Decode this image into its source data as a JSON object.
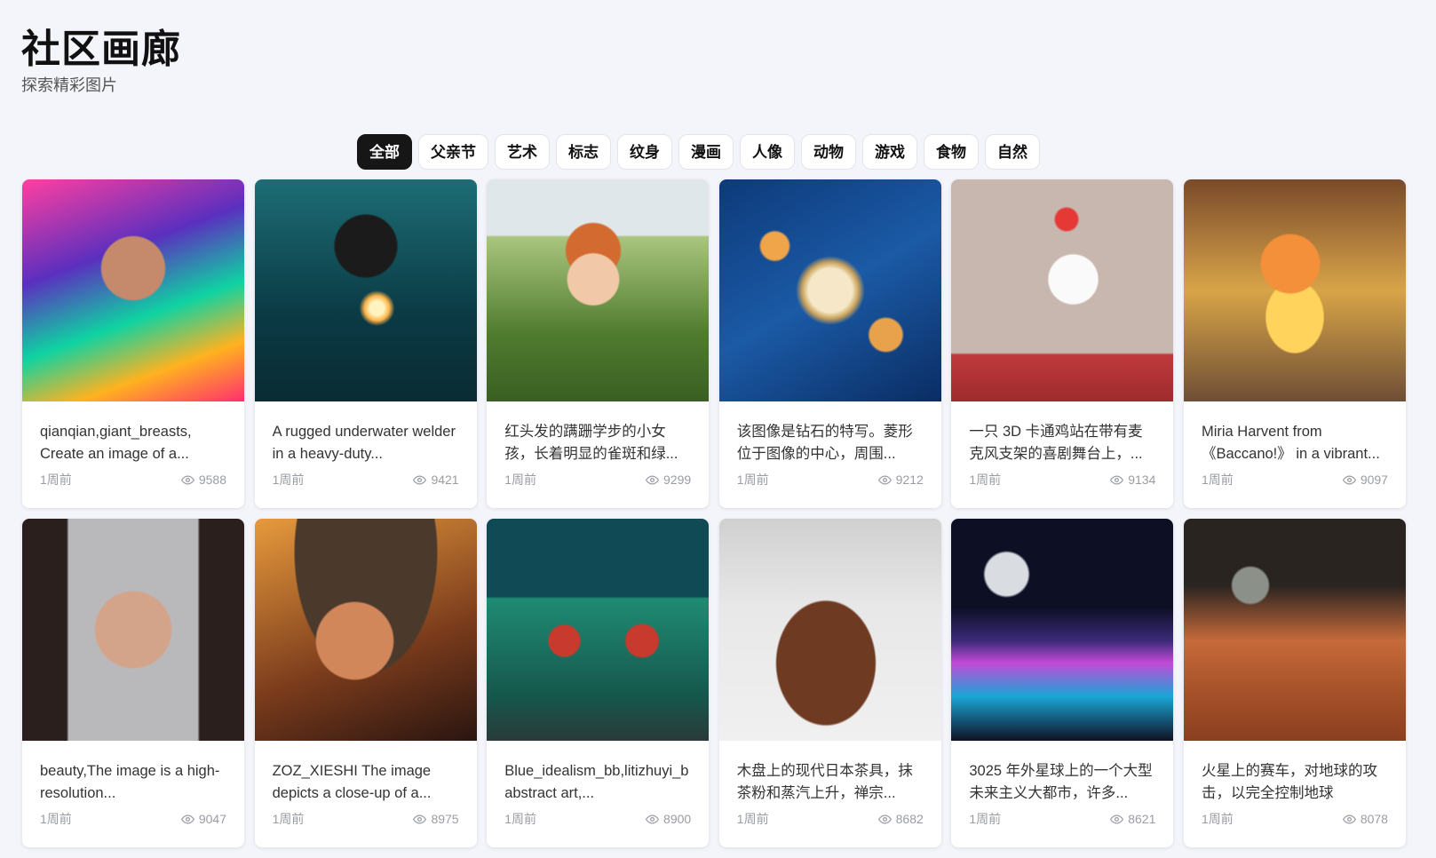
{
  "header": {
    "title": "社区画廊",
    "subtitle": "探索精彩图片"
  },
  "tabs": [
    {
      "label": "全部",
      "active": true
    },
    {
      "label": "父亲节"
    },
    {
      "label": "艺术"
    },
    {
      "label": "标志"
    },
    {
      "label": "纹身"
    },
    {
      "label": "漫画"
    },
    {
      "label": "人像"
    },
    {
      "label": "动物"
    },
    {
      "label": "游戏"
    },
    {
      "label": "食物"
    },
    {
      "label": "自然"
    }
  ],
  "cards": [
    {
      "caption": "qianqian,giant_breasts, Create an image of a...",
      "time": "1周前",
      "views": "9588"
    },
    {
      "caption": "A rugged underwater welder in a heavy-duty...",
      "time": "1周前",
      "views": "9421"
    },
    {
      "caption": "红头发的蹒跚学步的小女孩，长着明显的雀斑和绿...",
      "time": "1周前",
      "views": "9299"
    },
    {
      "caption": "该图像是钻石的特写。菱形位于图像的中心，周围...",
      "time": "1周前",
      "views": "9212"
    },
    {
      "caption": "一只 3D 卡通鸡站在带有麦克风支架的喜剧舞台上，...",
      "time": "1周前",
      "views": "9134"
    },
    {
      "caption": "Miria Harvent from 《Baccano!》 in a vibrant...",
      "time": "1周前",
      "views": "9097"
    },
    {
      "caption": "beauty,The image is a high-resolution...",
      "time": "1周前",
      "views": "9047"
    },
    {
      "caption": "ZOZ_XIESHI The image depicts a close-up of a...",
      "time": "1周前",
      "views": "8975"
    },
    {
      "caption": "Blue_idealism_bb,litizhuyi_b abstract art,...",
      "time": "1周前",
      "views": "8900"
    },
    {
      "caption": "木盘上的现代日本茶具，抹茶粉和蒸汽上升，禅宗...",
      "time": "1周前",
      "views": "8682"
    },
    {
      "caption": "3025 年外星球上的一个大型未来主义大都市，许多...",
      "time": "1周前",
      "views": "8621"
    },
    {
      "caption": "火星上的赛车，对地球的攻击，以完全控制地球",
      "time": "1周前",
      "views": "8078"
    }
  ]
}
